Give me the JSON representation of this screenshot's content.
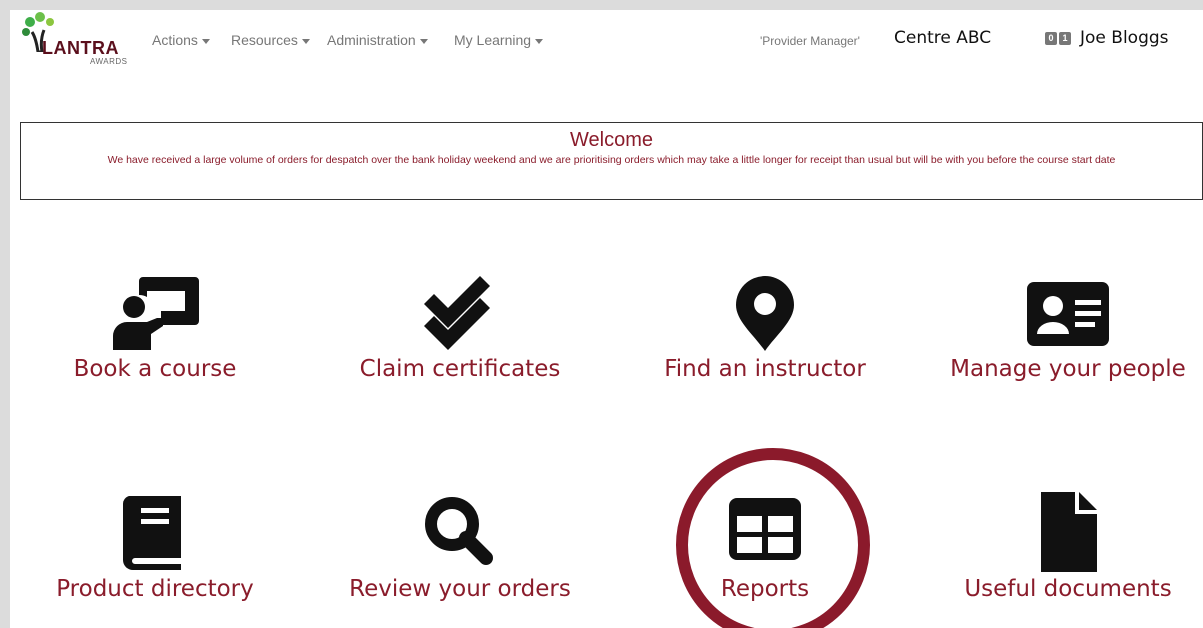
{
  "brand": {
    "name": "LANTRA",
    "sub": "AWARDS"
  },
  "nav": [
    {
      "label": "Actions"
    },
    {
      "label": "Resources"
    },
    {
      "label": "Administration"
    },
    {
      "label": "My Learning"
    }
  ],
  "account": {
    "role": "'Provider Manager'",
    "centre": "Centre ABC",
    "badge_a": "0",
    "badge_b": "1",
    "user": "Joe Bloggs"
  },
  "welcome": {
    "title": "Welcome",
    "body": "We have received a large volume of orders for despatch over the bank holiday weekend and we are prioritising orders which may take a little longer for receipt than usual but will be with you before the course start date"
  },
  "tiles": [
    {
      "label": "Book a course",
      "icon": "presentation-person-icon"
    },
    {
      "label": "Claim certificates",
      "icon": "double-check-icon"
    },
    {
      "label": "Find an instructor",
      "icon": "map-marker-icon"
    },
    {
      "label": "Manage your people",
      "icon": "id-card-icon"
    },
    {
      "label": "Product directory",
      "icon": "book-icon"
    },
    {
      "label": "Review your orders",
      "icon": "search-icon"
    },
    {
      "label": "Reports",
      "icon": "table-icon"
    },
    {
      "label": "Useful documents",
      "icon": "file-icon"
    }
  ],
  "colors": {
    "accent": "#8a1c2b",
    "highlight": "#8b1a2b"
  }
}
